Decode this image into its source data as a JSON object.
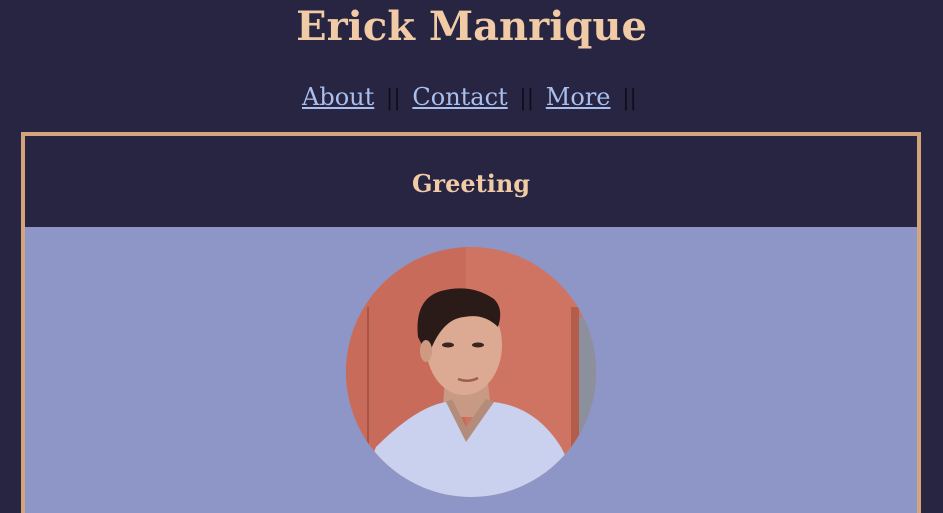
{
  "header": {
    "title": "Erick Manrique"
  },
  "nav": {
    "links": [
      "About",
      "Contact",
      "More"
    ],
    "separator": "||"
  },
  "card": {
    "title": "Greeting",
    "image_subject": "portrait-photo"
  },
  "colors": {
    "background": "#272542",
    "title": "#f0cba5",
    "link": "#a9bfee",
    "card_border": "#d4a47d",
    "card_body": "#8d96c6"
  }
}
